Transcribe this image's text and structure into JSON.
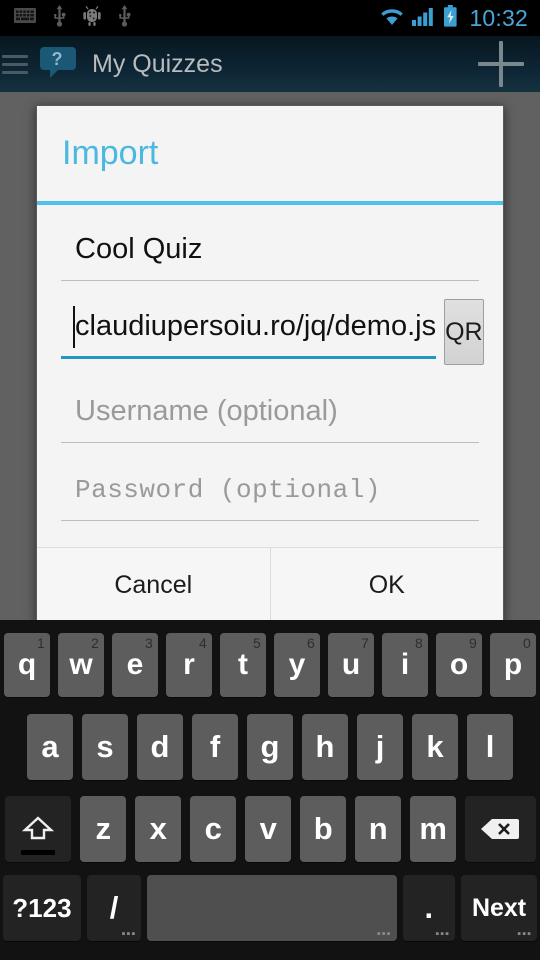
{
  "status_bar": {
    "icons": [
      "keyboard-icon",
      "usb-icon",
      "android-debug-icon",
      "usb-icon"
    ],
    "wifi_icon": "wifi-icon",
    "signal_icon": "signal-bars-icon",
    "battery_icon": "battery-charging-icon",
    "time": "10:32",
    "clock_color": "#48a6d8",
    "background": "#000000"
  },
  "action_bar": {
    "menu_icon": "hamburger-menu-icon",
    "app_icon": "quiz-bubble-icon",
    "title": "My Quizzes",
    "add_label": "+",
    "background": "#0d2534",
    "title_color": "#b9bcbd"
  },
  "dialog": {
    "title": "Import",
    "title_color": "#4bb8e0",
    "divider_color": "#4fc0e8",
    "background": "#f4f4f4",
    "fields": [
      {
        "name": "quiz-name",
        "value": "Cool Quiz",
        "placeholder": "",
        "focused": false,
        "mono": false
      },
      {
        "name": "url",
        "value": "claudiupersoiu.ro/jq/demo.js",
        "placeholder": "",
        "focused": true,
        "mono": false
      },
      {
        "name": "username",
        "value": "",
        "placeholder": "Username (optional)",
        "focused": false,
        "mono": false
      },
      {
        "name": "password",
        "value": "",
        "placeholder": "Password (optional)",
        "focused": false,
        "mono": true
      }
    ],
    "qr_button": "QR",
    "cancel_label": "Cancel",
    "ok_label": "OK",
    "focus_underline_color": "#2196be"
  },
  "keyboard": {
    "background": "#121212",
    "row1": [
      {
        "key": "q",
        "num": "1"
      },
      {
        "key": "w",
        "num": "2"
      },
      {
        "key": "e",
        "num": "3"
      },
      {
        "key": "r",
        "num": "4"
      },
      {
        "key": "t",
        "num": "5"
      },
      {
        "key": "y",
        "num": "6"
      },
      {
        "key": "u",
        "num": "7"
      },
      {
        "key": "i",
        "num": "8"
      },
      {
        "key": "o",
        "num": "9"
      },
      {
        "key": "p",
        "num": "0"
      }
    ],
    "row2": [
      "a",
      "s",
      "d",
      "f",
      "g",
      "h",
      "j",
      "k",
      "l"
    ],
    "row3": {
      "shift": "shift-key-icon",
      "letters": [
        "z",
        "x",
        "c",
        "v",
        "b",
        "n",
        "m"
      ],
      "backspace": "backspace-key-icon"
    },
    "row4": {
      "symbols_label": "?123",
      "slash_label": "/",
      "space_label": "",
      "period_label": ".",
      "next_label": "Next",
      "hint_dots": "▪▪▪"
    }
  },
  "scrim_color": "#616161"
}
